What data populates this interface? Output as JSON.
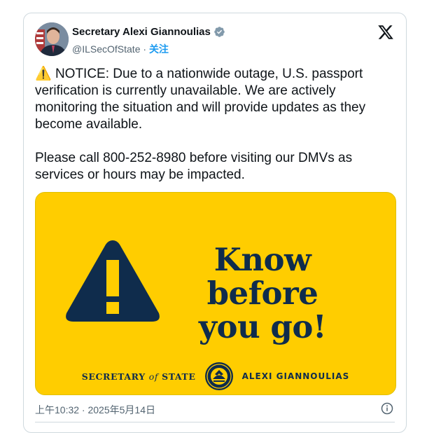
{
  "tweet": {
    "author_name": "Secretary Alexi Giannoulias",
    "handle": "@ILSecOfState",
    "separator": "·",
    "follow_label": "关注",
    "warning_emoji": "⚠️",
    "paragraph_1": "NOTICE: Due to a nationwide outage, U.S. passport verification is currently unavailable. We are actively monitoring the situation and will provide updates as they become available.",
    "paragraph_2": "Please call 800-252-8980 before visiting our DMVs as services or hours may be impacted.",
    "timestamp": "上午10:32 · 2025年5月14日"
  },
  "media": {
    "headline_line1": "Know before",
    "headline_line2": "you go!",
    "sos_part1": "SECRETARY",
    "sos_of": "of",
    "sos_part2": "STATE",
    "official_name": "ALEXI GIANNOULIAS"
  },
  "colors": {
    "accent": "#1d9bf0",
    "media_bg": "#ffcd00",
    "navy": "#0f2c4c"
  },
  "icons": [
    "verified-badge-icon",
    "x-logo-icon",
    "warning-icon",
    "info-icon"
  ]
}
